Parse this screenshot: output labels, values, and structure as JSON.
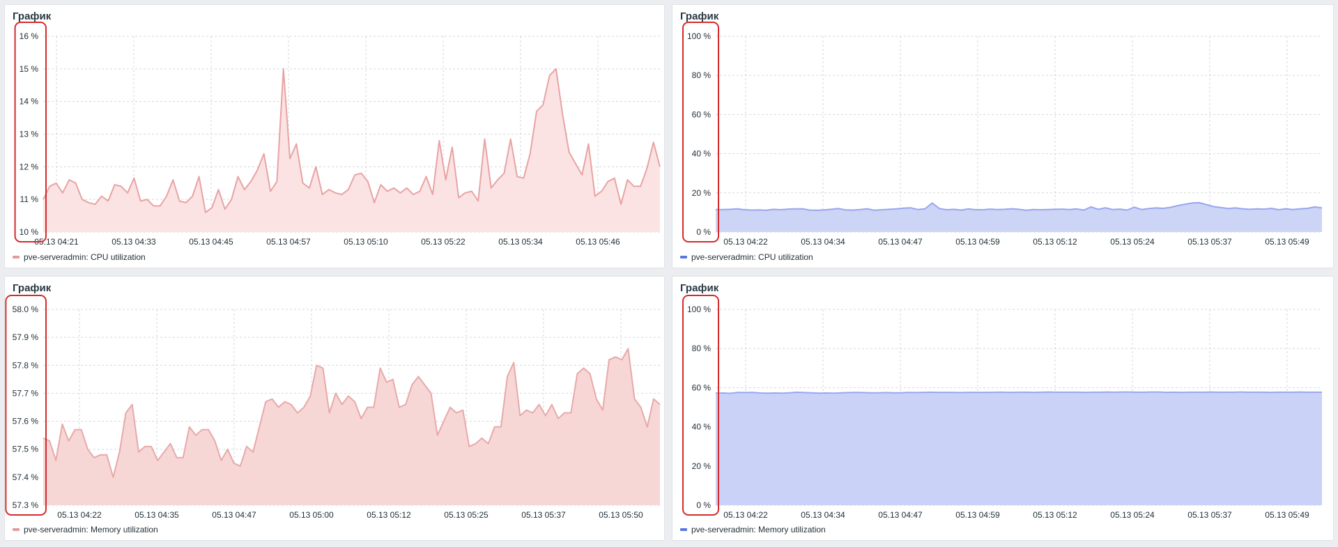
{
  "panels": [
    {
      "title": "График",
      "legend": "pve-serveradmin: CPU utilization",
      "colors": {
        "line": "#e8a3a3",
        "fill": "#fbe3e3",
        "swatch": "#e39a9a"
      },
      "chart_data": {
        "type": "area",
        "y_ticks": [
          "10 %",
          "11 %",
          "12 %",
          "13 %",
          "14 %",
          "15 %",
          "16 %"
        ],
        "ylim": [
          10,
          16
        ],
        "x_ticks": [
          "05.13 04:21",
          "05.13 04:33",
          "05.13 04:45",
          "05.13 04:57",
          "05.13 05:10",
          "05.13 05:22",
          "05.13 05:34",
          "05.13 05:46"
        ],
        "series": [
          {
            "values": [
              11.0,
              11.4,
              11.5,
              11.2,
              11.6,
              11.5,
              11.0,
              10.9,
              10.85,
              11.1,
              10.95,
              11.45,
              11.4,
              11.2,
              11.65,
              10.95,
              11.0,
              10.8,
              10.8,
              11.1,
              11.6,
              10.95,
              10.9,
              11.1,
              11.7,
              10.6,
              10.75,
              11.3,
              10.7,
              11.0,
              11.7,
              11.3,
              11.55,
              11.9,
              12.4,
              11.25,
              11.55,
              15.0,
              12.25,
              12.7,
              11.5,
              11.35,
              12.0,
              11.15,
              11.3,
              11.2,
              11.15,
              11.3,
              11.75,
              11.8,
              11.55,
              10.9,
              11.45,
              11.25,
              11.35,
              11.2,
              11.35,
              11.15,
              11.25,
              11.7,
              11.15,
              12.8,
              11.6,
              12.6,
              11.05,
              11.2,
              11.25,
              10.95,
              12.85,
              11.35,
              11.6,
              11.8,
              12.85,
              11.7,
              11.65,
              12.4,
              13.7,
              13.9,
              14.8,
              15.0,
              13.6,
              12.45,
              12.1,
              11.75,
              12.7,
              11.1,
              11.25,
              11.55,
              11.65,
              10.85,
              11.6,
              11.4,
              11.4,
              11.95,
              12.75,
              12.0
            ]
          }
        ]
      }
    },
    {
      "title": "График",
      "legend": "pve-serveradmin: CPU utilization",
      "colors": {
        "line": "#98a5ee",
        "fill": "#cdd5f7",
        "swatch": "#5a77e0"
      },
      "chart_data": {
        "type": "area",
        "y_ticks": [
          "0 %",
          "20 %",
          "40 %",
          "60 %",
          "80 %",
          "100 %"
        ],
        "ylim": [
          0,
          100
        ],
        "x_ticks": [
          "05.13 04:22",
          "05.13 04:34",
          "05.13 04:47",
          "05.13 04:59",
          "05.13 05:12",
          "05.13 05:24",
          "05.13 05:37",
          "05.13 05:49"
        ],
        "series": [
          {
            "values": [
              11.5,
              11.5,
              11.6,
              11.8,
              11.4,
              11.2,
              11.3,
              11.1,
              11.6,
              11.4,
              11.7,
              11.8,
              11.9,
              11.2,
              11.1,
              11.3,
              11.6,
              12.0,
              11.3,
              11.2,
              11.5,
              11.9,
              11.1,
              11.4,
              11.6,
              11.8,
              12.2,
              12.4,
              11.5,
              11.9,
              14.8,
              12.0,
              11.4,
              11.6,
              11.2,
              11.8,
              11.4,
              11.4,
              11.7,
              11.5,
              11.6,
              11.9,
              11.6,
              11.1,
              11.5,
              11.4,
              11.5,
              11.6,
              11.7,
              11.5,
              11.8,
              11.2,
              12.8,
              11.6,
              12.4,
              11.5,
              11.7,
              11.2,
              12.7,
              11.5,
              12.0,
              12.3,
              12.1,
              12.6,
              13.5,
              14.2,
              14.8,
              15.0,
              14.0,
              13.0,
              12.5,
              12.0,
              12.3,
              11.9,
              11.6,
              11.8,
              11.7,
              12.1,
              11.4,
              11.9,
              11.5,
              11.9,
              12.1,
              12.8,
              12.3
            ]
          }
        ]
      }
    },
    {
      "title": "График",
      "legend": "pve-serveradmin: Memory utilization",
      "colors": {
        "line": "#e8a9a9",
        "fill": "#f7d6d6",
        "swatch": "#e39a9a"
      },
      "chart_data": {
        "type": "area",
        "y_ticks": [
          "57.3 %",
          "57.4 %",
          "57.5 %",
          "57.6 %",
          "57.7 %",
          "57.8 %",
          "57.9 %",
          "58.0 %"
        ],
        "ylim": [
          57.3,
          58.0
        ],
        "x_ticks": [
          "05.13 04:22",
          "05.13 04:35",
          "05.13 04:47",
          "05.13 05:00",
          "05.13 05:12",
          "05.13 05:25",
          "05.13 05:37",
          "05.13 05:50"
        ],
        "series": [
          {
            "values": [
              57.54,
              57.53,
              57.46,
              57.59,
              57.53,
              57.57,
              57.57,
              57.5,
              57.47,
              57.48,
              57.48,
              57.4,
              57.49,
              57.63,
              57.66,
              57.49,
              57.51,
              57.51,
              57.46,
              57.49,
              57.52,
              57.47,
              57.47,
              57.58,
              57.55,
              57.57,
              57.57,
              57.53,
              57.46,
              57.5,
              57.45,
              57.44,
              57.51,
              57.49,
              57.58,
              57.67,
              57.68,
              57.65,
              57.67,
              57.66,
              57.63,
              57.65,
              57.69,
              57.8,
              57.79,
              57.63,
              57.7,
              57.66,
              57.69,
              57.67,
              57.61,
              57.65,
              57.65,
              57.79,
              57.74,
              57.75,
              57.65,
              57.66,
              57.73,
              57.76,
              57.73,
              57.7,
              57.55,
              57.6,
              57.65,
              57.63,
              57.64,
              57.51,
              57.52,
              57.54,
              57.52,
              57.58,
              57.58,
              57.76,
              57.81,
              57.62,
              57.64,
              57.63,
              57.66,
              57.62,
              57.66,
              57.61,
              57.63,
              57.63,
              57.77,
              57.79,
              57.77,
              57.68,
              57.64,
              57.82,
              57.83,
              57.82,
              57.86,
              57.68,
              57.65,
              57.58,
              57.68,
              57.66
            ]
          }
        ]
      }
    },
    {
      "title": "График",
      "legend": "pve-serveradmin: Memory utilization",
      "colors": {
        "line": "#9aa8ee",
        "fill": "#cad3f7",
        "swatch": "#5a77e0"
      },
      "chart_data": {
        "type": "area",
        "y_ticks": [
          "0 %",
          "20 %",
          "40 %",
          "60 %",
          "80 %",
          "100 %"
        ],
        "ylim": [
          0,
          100
        ],
        "x_ticks": [
          "05.13 04:22",
          "05.13 04:34",
          "05.13 04:47",
          "05.13 04:59",
          "05.13 05:12",
          "05.13 05:24",
          "05.13 05:37",
          "05.13 05:49"
        ],
        "series": [
          {
            "values": [
              57.2,
              57.3,
              57.1,
              57.6,
              57.5,
              57.6,
              57.3,
              57.2,
              57.3,
              57.2,
              57.4,
              57.7,
              57.5,
              57.4,
              57.2,
              57.3,
              57.2,
              57.4,
              57.5,
              57.6,
              57.5,
              57.4,
              57.4,
              57.5,
              57.4,
              57.4,
              57.6,
              57.5,
              57.6,
              57.7,
              57.6,
              57.6,
              57.6,
              57.5,
              57.6,
              57.6,
              57.6,
              57.6,
              57.7,
              57.7,
              57.6,
              57.7,
              57.7,
              57.6,
              57.7,
              57.8,
              57.7,
              57.7,
              57.7,
              57.7,
              57.6,
              57.7,
              57.7,
              57.8,
              57.7,
              57.8,
              57.8,
              57.7,
              57.7,
              57.8,
              57.8,
              57.6,
              57.7,
              57.6,
              57.7,
              57.7,
              57.7,
              57.8,
              57.7,
              57.7,
              57.7,
              57.8,
              57.7,
              57.7,
              57.7,
              57.6,
              57.7,
              57.7,
              57.7,
              57.8,
              57.7,
              57.7,
              57.7
            ]
          }
        ]
      }
    }
  ]
}
